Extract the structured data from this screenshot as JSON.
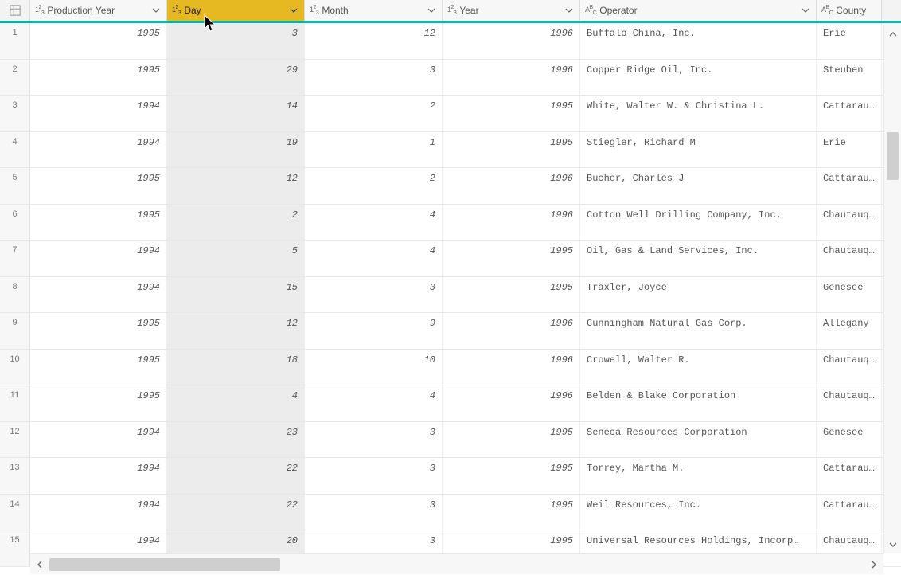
{
  "columns": [
    {
      "label": "Production Year",
      "type": "num"
    },
    {
      "label": "Day",
      "type": "num"
    },
    {
      "label": "Month",
      "type": "num"
    },
    {
      "label": "Year",
      "type": "num"
    },
    {
      "label": "Operator",
      "type": "text"
    },
    {
      "label": "County",
      "type": "text"
    }
  ],
  "selected_column_index": 1,
  "rows": [
    {
      "n": 1,
      "prod_year": "1995",
      "day": "3",
      "month": "12",
      "year": "1996",
      "operator": "Buffalo China, Inc.",
      "county": "Erie"
    },
    {
      "n": 2,
      "prod_year": "1995",
      "day": "29",
      "month": "3",
      "year": "1996",
      "operator": "Copper Ridge Oil, Inc.",
      "county": "Steuben"
    },
    {
      "n": 3,
      "prod_year": "1994",
      "day": "14",
      "month": "2",
      "year": "1995",
      "operator": "White, Walter W. & Christina L.",
      "county": "Cattaraugu"
    },
    {
      "n": 4,
      "prod_year": "1994",
      "day": "19",
      "month": "1",
      "year": "1995",
      "operator": "Stiegler, Richard M",
      "county": "Erie"
    },
    {
      "n": 5,
      "prod_year": "1995",
      "day": "12",
      "month": "2",
      "year": "1996",
      "operator": "Bucher, Charles J",
      "county": "Cattaraugu"
    },
    {
      "n": 6,
      "prod_year": "1995",
      "day": "2",
      "month": "4",
      "year": "1996",
      "operator": "Cotton Well Drilling Company,  Inc.",
      "county": "Chautauqua"
    },
    {
      "n": 7,
      "prod_year": "1994",
      "day": "5",
      "month": "4",
      "year": "1995",
      "operator": "Oil, Gas & Land Services, Inc.",
      "county": "Chautauqua"
    },
    {
      "n": 8,
      "prod_year": "1994",
      "day": "15",
      "month": "3",
      "year": "1995",
      "operator": "Traxler, Joyce",
      "county": "Genesee"
    },
    {
      "n": 9,
      "prod_year": "1995",
      "day": "12",
      "month": "9",
      "year": "1996",
      "operator": "Cunningham Natural Gas Corp.",
      "county": "Allegany"
    },
    {
      "n": 10,
      "prod_year": "1995",
      "day": "18",
      "month": "10",
      "year": "1996",
      "operator": "Crowell, Walter R.",
      "county": "Chautauqua"
    },
    {
      "n": 11,
      "prod_year": "1995",
      "day": "4",
      "month": "4",
      "year": "1996",
      "operator": "Belden & Blake Corporation",
      "county": "Chautauqua"
    },
    {
      "n": 12,
      "prod_year": "1994",
      "day": "23",
      "month": "3",
      "year": "1995",
      "operator": "Seneca Resources Corporation",
      "county": "Genesee"
    },
    {
      "n": 13,
      "prod_year": "1994",
      "day": "22",
      "month": "3",
      "year": "1995",
      "operator": "Torrey, Martha M.",
      "county": "Cattaraugu"
    },
    {
      "n": 14,
      "prod_year": "1994",
      "day": "22",
      "month": "3",
      "year": "1995",
      "operator": "Weil Resources, Inc.",
      "county": "Cattaraugu"
    },
    {
      "n": 15,
      "prod_year": "1994",
      "day": "20",
      "month": "3",
      "year": "1995",
      "operator": "Universal Resources Holdings, Incorp…",
      "county": "Chautauqua"
    }
  ]
}
